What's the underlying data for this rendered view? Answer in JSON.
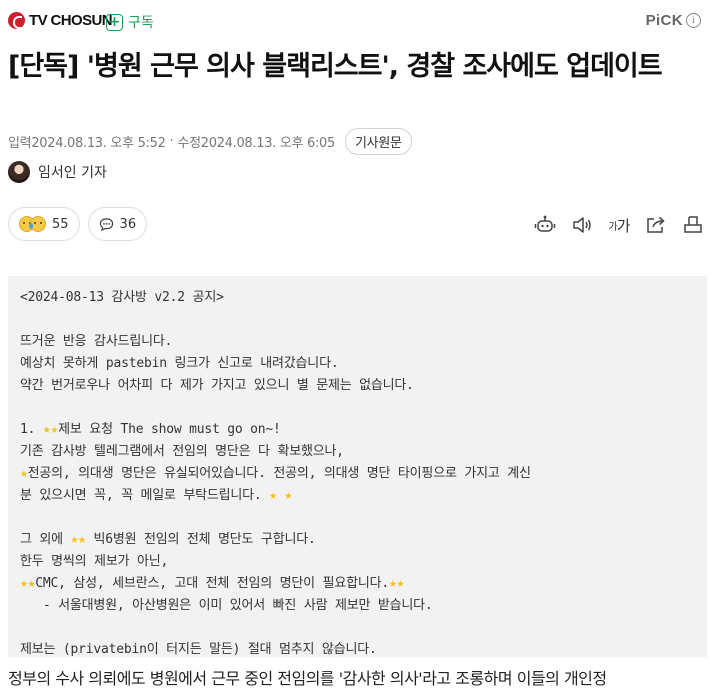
{
  "header": {
    "brand": "TV CHOSUN",
    "subscribe_label": "구독",
    "pick_label": "PiCK",
    "info_symbol": "i"
  },
  "article": {
    "headline": "[단독] '병원 근무 의사 블랙리스트', 경찰 조사에도 업데이트",
    "meta": {
      "published_label": "입력",
      "published": "2024.08.13. 오후 5:52",
      "separator": "·",
      "modified_label": "수정",
      "modified": "2024.08.13. 오후 6:05",
      "original_button": "기사원문"
    },
    "author": "임서인 기자",
    "reactions": {
      "count": "55"
    },
    "comments": {
      "count": "36"
    },
    "tools": [
      "summary-bot-icon",
      "audio-icon",
      "font-size-icon",
      "share-icon",
      "print-icon"
    ],
    "font_tool_label_small": "가",
    "font_tool_label_large": "가",
    "notice_lines": [
      [
        {
          "t": "<2024-08-13 감사방 v2.2 공지>"
        }
      ],
      [],
      [
        {
          "t": "뜨거운 반응 감사드립니다."
        }
      ],
      [
        {
          "t": "예상치 못하게 pastebin 링크가 신고로 내려갔습니다."
        }
      ],
      [
        {
          "t": "약간 번거로우나 어차피 다 제가 가지고 있으니 별 문제는 없습니다."
        }
      ],
      [],
      [
        {
          "t": "1. "
        },
        {
          "s": "★★"
        },
        {
          "t": "제보 요청 The show must go on~!"
        }
      ],
      [
        {
          "t": "기존 감사방 텔레그램에서 전임의 명단은 다 확보했으나,"
        }
      ],
      [
        {
          "s": "★"
        },
        {
          "t": "전공의, 의대생 명단은 유실되어있습니다. 전공의, 의대생 명단 타이핑으로 가지고 계신"
        }
      ],
      [
        {
          "t": "분 있으시면 꼭, 꼭 메일로 부탁드립니다. "
        },
        {
          "s": "★ ★"
        }
      ],
      [],
      [
        {
          "t": "그 외에 "
        },
        {
          "s": "★★"
        },
        {
          "t": " 빅6병원 전임의 전체 명단도 구합니다."
        }
      ],
      [
        {
          "t": "한두 명씩의 제보가 아닌,"
        }
      ],
      [
        {
          "s": "★★"
        },
        {
          "t": "CMC, 삼성, 세브란스, 고대 전체 전임의 명단이 필요합니다."
        },
        {
          "s": "★★"
        }
      ],
      [
        {
          "t": "   - 서울대병원, 아산병원은 이미 있어서 빠진 사람 제보만 받습니다."
        }
      ],
      [],
      [
        {
          "t": "제보는 (privatebin이 터지든 말든) 절대 멈추지 않습니다."
        }
      ]
    ],
    "body_preview": "정부의 수사 의뢰에도 병원에서 근무 중인 전임의를 '감사한 의사'라고 조롱하며 이들의 개인정"
  },
  "colors": {
    "brand_red": "#d21e2b",
    "subscribe_green": "#1a9f57",
    "notice_bg": "#f2f2f2",
    "star": "#f2c21b"
  }
}
